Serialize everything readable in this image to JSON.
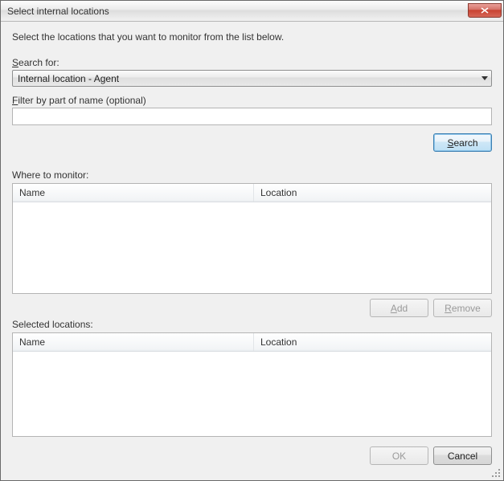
{
  "window": {
    "title": "Select internal locations"
  },
  "instructions": "Select the locations that you want to monitor from the list below.",
  "search": {
    "label_prefix": "S",
    "label_rest": "earch for:",
    "dropdown_value": "Internal location - Agent",
    "filter_label_prefix": "F",
    "filter_label_rest": "ilter by part of name (optional)",
    "filter_value": "",
    "search_btn_prefix": "S",
    "search_btn_rest": "earch"
  },
  "where_to_monitor": {
    "label": "Where to monitor:",
    "columns": {
      "name": "Name",
      "location": "Location"
    },
    "rows": []
  },
  "add_remove": {
    "add_prefix": "A",
    "add_rest": "dd",
    "remove_prefix": "R",
    "remove_rest": "emove"
  },
  "selected_locations": {
    "label": "Selected locations:",
    "columns": {
      "name": "Name",
      "location": "Location"
    },
    "rows": []
  },
  "dialog_buttons": {
    "ok": "OK",
    "cancel": "Cancel"
  }
}
